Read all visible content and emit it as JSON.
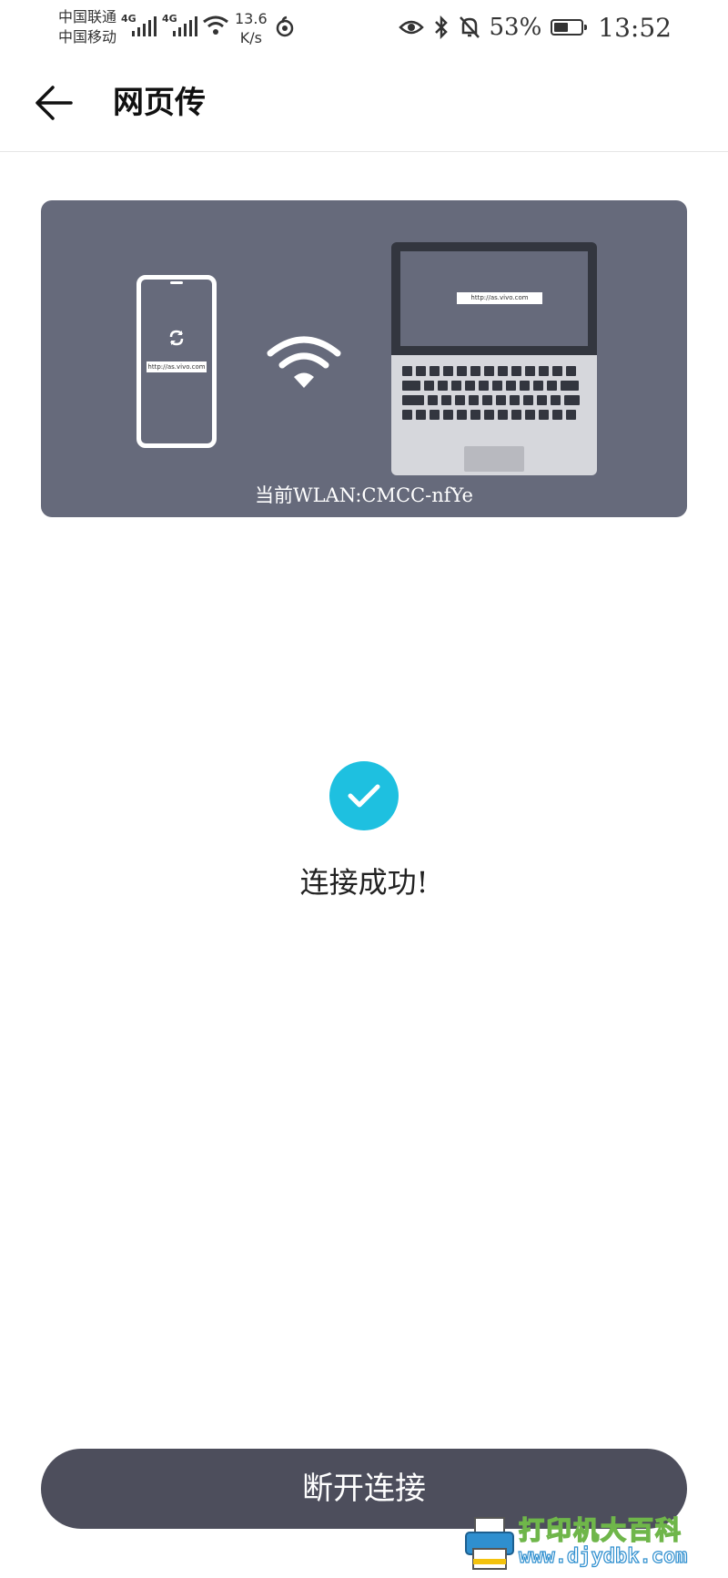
{
  "status_bar": {
    "carrier_1": "中国联通",
    "carrier_2": "中国移动",
    "network_1": "4G",
    "network_2": "4G",
    "speed_value": "13.6",
    "speed_unit": "K/s",
    "battery_percent": "53%",
    "battery_level": 0.53,
    "time": "13:52",
    "icons": [
      "signal-icon",
      "wifi-icon",
      "netease-music-icon",
      "eye-icon",
      "bluetooth-icon",
      "notifications-off-icon",
      "battery-icon"
    ]
  },
  "header": {
    "title": "网页传",
    "back_icon": "arrow-left-icon"
  },
  "illustration": {
    "phone_url": "http://as.vivo.com",
    "laptop_url": "http://as.vivo.com",
    "wlan_label": "当前WLAN:CMCC-nfYe",
    "background_color": "#666a7b"
  },
  "status": {
    "success_text": "连接成功!",
    "check_color": "#1ec0e0"
  },
  "actions": {
    "disconnect_label": "断开连接",
    "button_color": "#4d4e5c"
  },
  "watermark": {
    "text_cn": "打印机大百科",
    "url": "www.djydbk.com"
  }
}
